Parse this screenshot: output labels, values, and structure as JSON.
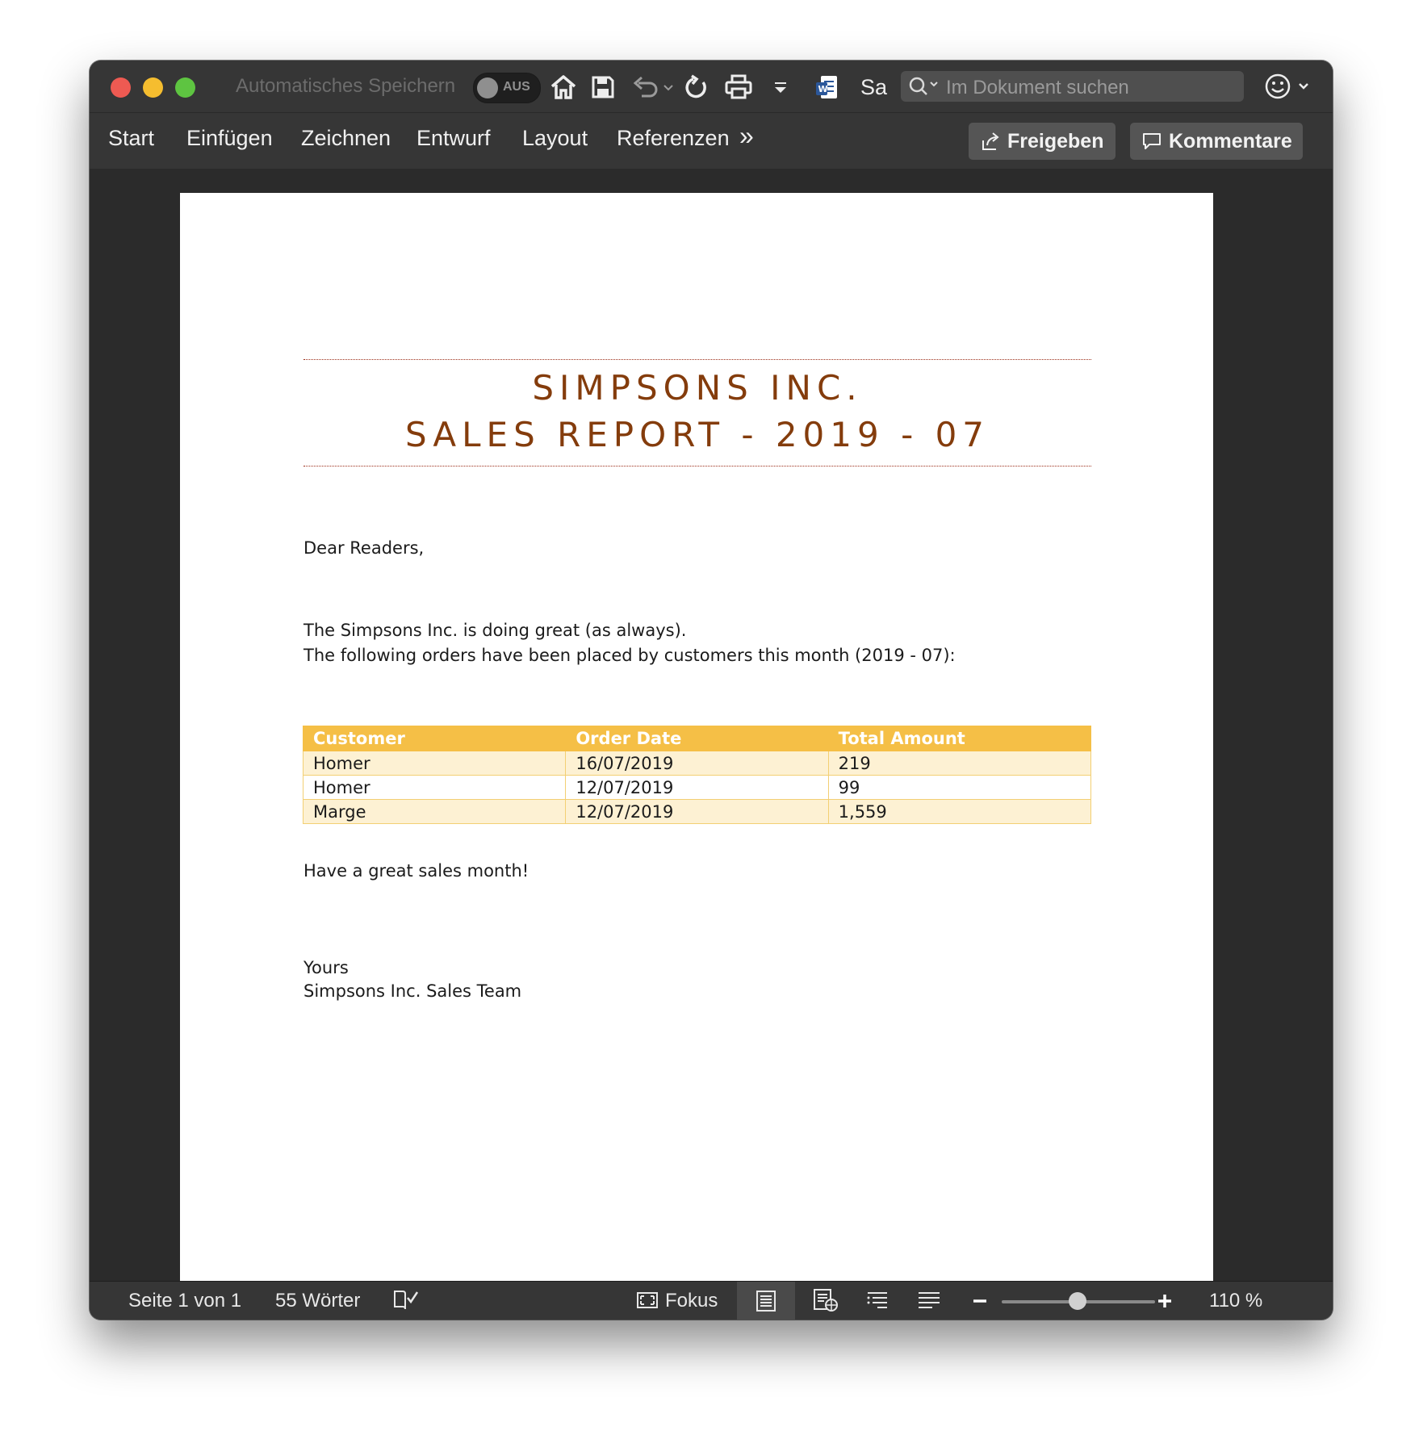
{
  "titlebar": {
    "autosave_label": "Automatisches Speichern",
    "autosave_toggle": "AUS",
    "doc_name": "Sa",
    "search_placeholder": "Im Dokument suchen"
  },
  "ribbon": {
    "tabs": [
      "Start",
      "Einfügen",
      "Zeichnen",
      "Entwurf",
      "Layout",
      "Referenzen"
    ],
    "more": "»",
    "share_label": "Freigeben",
    "comments_label": "Kommentare"
  },
  "document": {
    "title_line1": "SIMPSONS INC.",
    "title_line2": "SALES REPORT - 2019 - 07",
    "greeting": "Dear Readers,",
    "para1": "The Simpsons Inc. is doing great (as always).",
    "para2": "The following orders have been placed by customers this month (2019 - 07):",
    "table": {
      "headers": [
        "Customer",
        "Order Date",
        "Total Amount"
      ],
      "rows": [
        [
          "Homer",
          "16/07/2019",
          "219"
        ],
        [
          "Homer",
          "12/07/2019",
          "99"
        ],
        [
          "Marge",
          "12/07/2019",
          "1,559"
        ]
      ]
    },
    "closing": "Have a great sales month!",
    "signoff1": "Yours",
    "signoff2": "Simpsons Inc. Sales Team",
    "title_color": "#843c0c",
    "table_header_color": "#f5bf46"
  },
  "statusbar": {
    "page": "Seite 1 von 1",
    "words": "55 Wörter",
    "focus": "Fokus",
    "zoom": "110 %",
    "zoom_percent": 110
  }
}
